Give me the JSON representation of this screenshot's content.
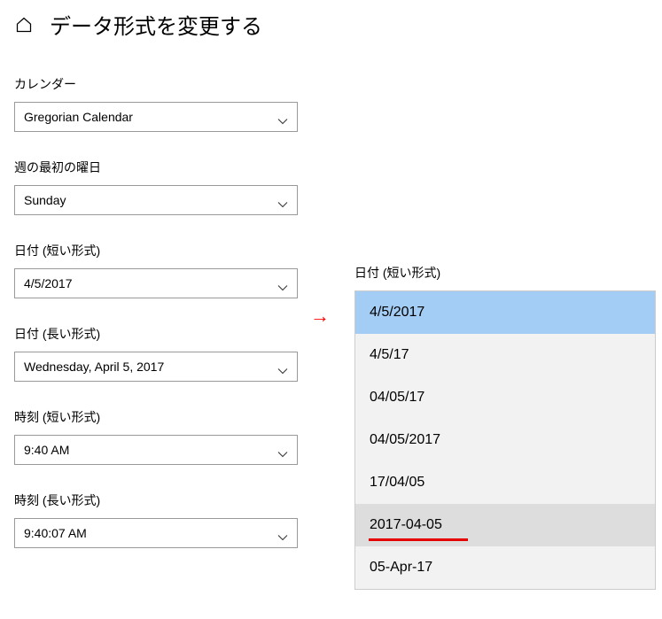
{
  "header": {
    "title": "データ形式を変更する"
  },
  "fields": {
    "calendar": {
      "label": "カレンダー",
      "value": "Gregorian Calendar"
    },
    "firstDayOfWeek": {
      "label": "週の最初の曜日",
      "value": "Sunday"
    },
    "shortDate": {
      "label": "日付 (短い形式)",
      "value": "4/5/2017"
    },
    "longDate": {
      "label": "日付 (長い形式)",
      "value": "Wednesday, April 5, 2017"
    },
    "shortTime": {
      "label": "時刻 (短い形式)",
      "value": "9:40 AM"
    },
    "longTime": {
      "label": "時刻 (長い形式)",
      "value": "9:40:07 AM"
    }
  },
  "arrow": "→",
  "dropdown": {
    "label": "日付 (短い形式)",
    "options": [
      "4/5/2017",
      "4/5/17",
      "04/05/17",
      "04/05/2017",
      "17/04/05",
      "2017-04-05",
      "05-Apr-17"
    ]
  }
}
